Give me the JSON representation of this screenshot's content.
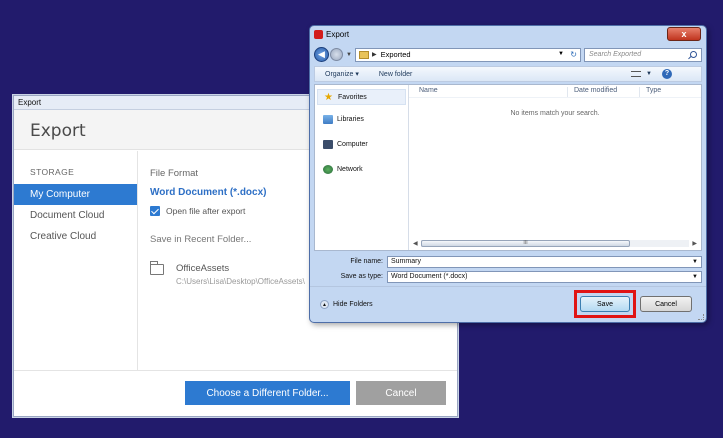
{
  "export_panel": {
    "titlebar": "Export",
    "header": "Export",
    "storage_heading": "STORAGE",
    "storage_items": [
      "My Computer",
      "Document Cloud",
      "Creative Cloud"
    ],
    "file_format_label": "File Format",
    "file_format_value": "Word Document (*.docx)",
    "open_after_label": "Open file after export",
    "recent_label": "Save in Recent Folder...",
    "recent_folder_name": "OfficeAssets",
    "recent_folder_path": "C:\\Users\\Lisa\\Desktop\\OfficeAssets\\",
    "choose_button": "Choose a Different Folder...",
    "cancel_button": "Cancel"
  },
  "save_dialog": {
    "title": "Export",
    "close": "x",
    "address_folder": "Exported",
    "search_placeholder": "Search Exported",
    "toolbar": {
      "organize": "Organize ▾",
      "new_folder": "New folder",
      "help": "?"
    },
    "nav": [
      "Favorites",
      "Libraries",
      "Computer",
      "Network"
    ],
    "columns": {
      "name": "Name",
      "date": "Date modified",
      "type": "Type"
    },
    "empty_message": "No items match your search.",
    "scroll_thumb": "III",
    "file_name_label": "File name:",
    "file_name_value": "Summary",
    "save_type_label": "Save as type:",
    "save_type_value": "Word Document (*.docx)",
    "hide_folders": "Hide Folders",
    "save_button": "Save",
    "cancel_button": "Cancel"
  },
  "colors": {
    "desktop": "#221b6c",
    "accent": "#2d7ad1",
    "highlight": "#e01414"
  }
}
